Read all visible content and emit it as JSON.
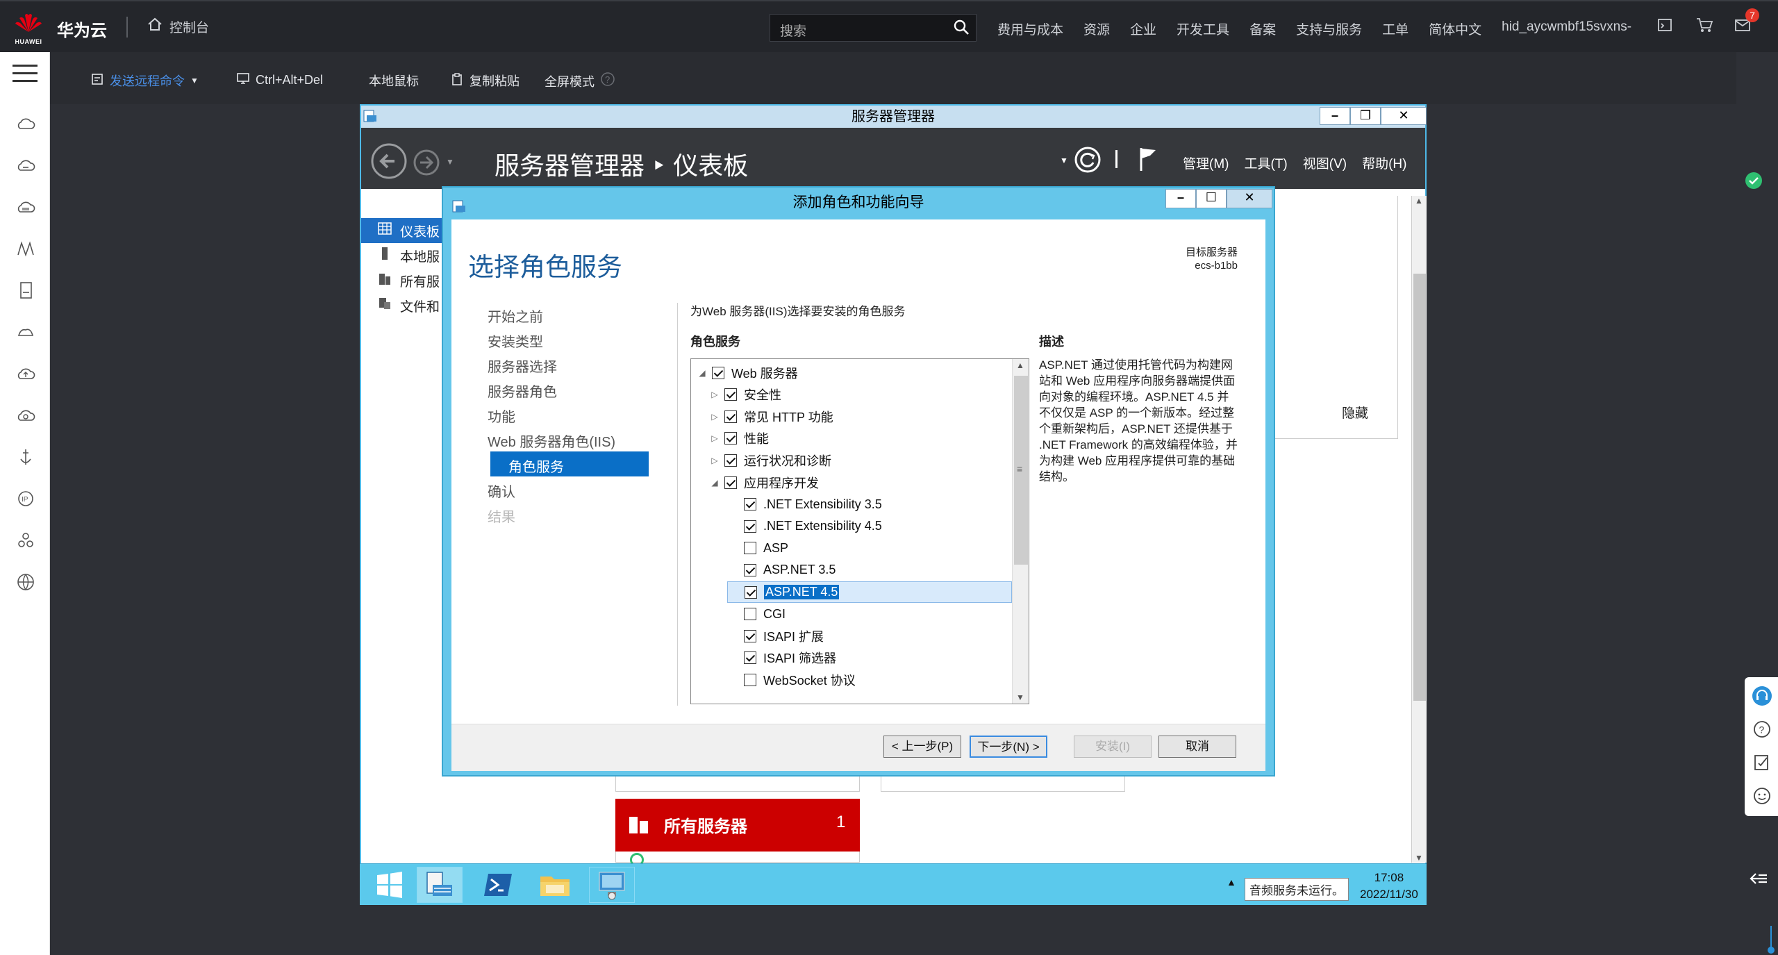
{
  "topnav": {
    "brand": "华为云",
    "logo_text": "HUAWEI",
    "console": "控制台",
    "search_placeholder": "搜索",
    "links": [
      "费用与成本",
      "资源",
      "企业",
      "开发工具",
      "备案",
      "支持与服务",
      "工单",
      "简体中文",
      "hid_aycwmbf15svxns-"
    ],
    "notification_count": "7"
  },
  "remote_toolbar": {
    "send_command": "发送远程命令",
    "ctrl_alt_del": "Ctrl+Alt+Del",
    "local_mouse": "本地鼠标",
    "copy_paste": "复制粘贴",
    "fullscreen": "全屏模式"
  },
  "server_manager": {
    "title": "服务器管理器",
    "breadcrumb": "服务器管理器 ‣ 仪表板",
    "menus": [
      "管理(M)",
      "工具(T)",
      "视图(V)",
      "帮助(H)"
    ],
    "nav": [
      "仪表板",
      "本地服",
      "所有服",
      "文件和"
    ],
    "hide": "隐藏",
    "all_servers_tile": "所有服务器",
    "all_servers_count": "1"
  },
  "wizard": {
    "title": "添加角色和功能向导",
    "heading": "选择角色服务",
    "target_label": "目标服务器",
    "target_server": "ecs-b1bb",
    "steps": [
      "开始之前",
      "安装类型",
      "服务器选择",
      "服务器角色",
      "功能",
      "Web 服务器角色(IIS)",
      "角色服务",
      "确认",
      "结果"
    ],
    "instruction": "为Web 服务器(IIS)选择要安装的角色服务",
    "roles_label": "角色服务",
    "description_label": "描述",
    "description": "ASP.NET 通过使用托管代码为构建网站和 Web 应用程序向服务器端提供面向对象的编程环境。ASP.NET 4.5 并不仅仅是 ASP 的一个新版本。经过整个重新架构后，ASP.NET 还提供基于 .NET Framework 的高效编程体验，并为构建 Web 应用程序提供可靠的基础结构。",
    "tree": [
      {
        "label": "Web 服务器",
        "checked": true,
        "expander": "◢",
        "level": 0
      },
      {
        "label": "安全性",
        "checked": true,
        "expander": "▷",
        "level": 1
      },
      {
        "label": "常见 HTTP 功能",
        "checked": true,
        "expander": "▷",
        "level": 1
      },
      {
        "label": "性能",
        "checked": true,
        "expander": "▷",
        "level": 1
      },
      {
        "label": "运行状况和诊断",
        "checked": true,
        "expander": "▷",
        "level": 1
      },
      {
        "label": "应用程序开发",
        "checked": true,
        "expander": "◢",
        "level": 1
      },
      {
        "label": ".NET Extensibility 3.5",
        "checked": true,
        "expander": "",
        "level": 2
      },
      {
        "label": ".NET Extensibility 4.5",
        "checked": true,
        "expander": "",
        "level": 2
      },
      {
        "label": "ASP",
        "checked": false,
        "expander": "",
        "level": 2
      },
      {
        "label": "ASP.NET 3.5",
        "checked": true,
        "expander": "",
        "level": 2
      },
      {
        "label": "ASP.NET 4.5",
        "checked": true,
        "expander": "",
        "level": 2,
        "selected": true
      },
      {
        "label": "CGI",
        "checked": false,
        "expander": "",
        "level": 2
      },
      {
        "label": "ISAPI 扩展",
        "checked": true,
        "expander": "",
        "level": 2
      },
      {
        "label": "ISAPI 筛选器",
        "checked": true,
        "expander": "",
        "level": 2
      },
      {
        "label": "WebSocket 协议",
        "checked": false,
        "expander": "",
        "level": 2
      }
    ],
    "buttons": {
      "prev": "< 上一步(P)",
      "next": "下一步(N) >",
      "install": "安装(I)",
      "cancel": "取消"
    }
  },
  "taskbar": {
    "tooltip": "音频服务未运行。",
    "time": "17:08",
    "date": "2022/11/30"
  }
}
